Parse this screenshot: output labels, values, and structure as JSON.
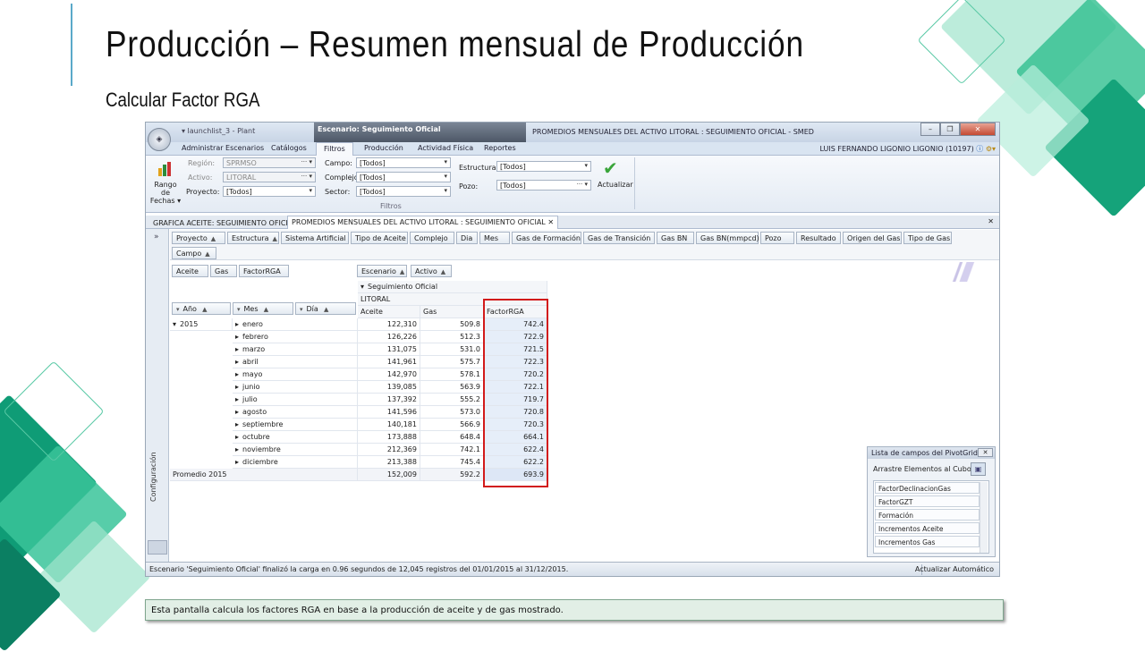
{
  "slide": {
    "title": "Producción – Resumen mensual de Producción",
    "subtitle": "Calcular Factor RGA",
    "caption": "Esta pantalla calcula los factores RGA en base a la producción de aceite y de gas mostrado."
  },
  "app": {
    "qat_text": "▾   launchlist_3 - Plant",
    "context_tab": "Escenario: Seguimiento Oficial",
    "window_title": "PROMEDIOS MENSUALES  DEL ACTIVO LITORAL : SEGUIMIENTO OFICIAL - SMED",
    "user": "LUIS FERNANDO LIGONIO LIGONIO (10197)",
    "ribbon_tabs": [
      "Administrar Escenarios",
      "Catálogos",
      "Filtros",
      "Producción",
      "Actividad Física",
      "Reportes"
    ],
    "active_ribbon_tab": "Filtros",
    "filters": {
      "rango_label": "Rango de Fechas ▾",
      "region_label": "Región:",
      "region_value": "SPRMSO",
      "activo_label": "Activo:",
      "activo_value": "LITORAL",
      "proyecto_label": "Proyecto:",
      "proyecto_value": "[Todos]",
      "campo_label": "Campo:",
      "campo_value": "[Todos]",
      "complejo_label": "Complejo:",
      "complejo_value": "[Todos]",
      "sector_label": "Sector:",
      "sector_value": "[Todos]",
      "estructura_label": "Estructura:",
      "estructura_value": "[Todos]",
      "pozo_label": "Pozo:",
      "pozo_value": "[Todos]",
      "actualizar_label": "Actualizar",
      "group_name": "Filtros"
    },
    "doc_tabs": [
      "GRAFICA ACEITE: SEGUIMIENTO OFICIAL",
      "PROMEDIOS MENSUALES  DEL ACTIVO LITORAL : SEGUIMIENTO OFICIAL"
    ],
    "sidebar_label": "Configuración",
    "filter_fields_row1": [
      "Proyecto",
      "Estructura",
      "Sistema Artificial",
      "Tipo de Aceite",
      "Complejo",
      "Dia",
      "Mes",
      "Gas de Formación",
      "Gas de Transición",
      "Gas BN",
      "Gas BN(mmpcd)",
      "Pozo",
      "Resultado",
      "Origen del Gas",
      "Tipo de Gas"
    ],
    "filter_fields_row2": [
      "Campo"
    ],
    "data_fields": [
      "Aceite",
      "Gas",
      "FactorRGA"
    ],
    "column_fields": [
      "Escenario",
      "Activo"
    ],
    "row_fields": [
      "Año",
      "Mes",
      "Día"
    ],
    "column_scenario": "Seguimiento Oficial",
    "column_activo": "LITORAL",
    "value_headers": [
      "Aceite",
      "Gas",
      "FactorRGA"
    ],
    "year": "2015",
    "rows": [
      {
        "mes": "enero",
        "aceite": "122,310",
        "gas": "509.8",
        "rga": "742.4"
      },
      {
        "mes": "febrero",
        "aceite": "126,226",
        "gas": "512.3",
        "rga": "722.9"
      },
      {
        "mes": "marzo",
        "aceite": "131,075",
        "gas": "531.0",
        "rga": "721.5"
      },
      {
        "mes": "abril",
        "aceite": "141,961",
        "gas": "575.7",
        "rga": "722.3"
      },
      {
        "mes": "mayo",
        "aceite": "142,970",
        "gas": "578.1",
        "rga": "720.2"
      },
      {
        "mes": "junio",
        "aceite": "139,085",
        "gas": "563.9",
        "rga": "722.1"
      },
      {
        "mes": "julio",
        "aceite": "137,392",
        "gas": "555.2",
        "rga": "719.7"
      },
      {
        "mes": "agosto",
        "aceite": "141,596",
        "gas": "573.0",
        "rga": "720.8"
      },
      {
        "mes": "septiembre",
        "aceite": "140,181",
        "gas": "566.9",
        "rga": "720.3"
      },
      {
        "mes": "octubre",
        "aceite": "173,888",
        "gas": "648.4",
        "rga": "664.1"
      },
      {
        "mes": "noviembre",
        "aceite": "212,369",
        "gas": "742.1",
        "rga": "622.4"
      },
      {
        "mes": "diciembre",
        "aceite": "213,388",
        "gas": "745.4",
        "rga": "622.2"
      }
    ],
    "total": {
      "label": "Promedio 2015",
      "aceite": "152,009",
      "gas": "592.2",
      "rga": "693.9"
    },
    "pivot_list": {
      "title": "Lista de campos del PivotGrid",
      "drag_text": "Arrastre Elementos al Cubo",
      "items": [
        "FactorDeclinacionGas",
        "FactorGZT",
        "Formación",
        "Incrementos Aceite",
        "Incrementos Gas"
      ]
    },
    "status_text": "Escenario 'Seguimiento Oficial' finalizó la carga en 0.96 segundos de 12,045 registros del 01/01/2015 al 31/12/2015.",
    "status_right": "Actualizar Automático"
  }
}
